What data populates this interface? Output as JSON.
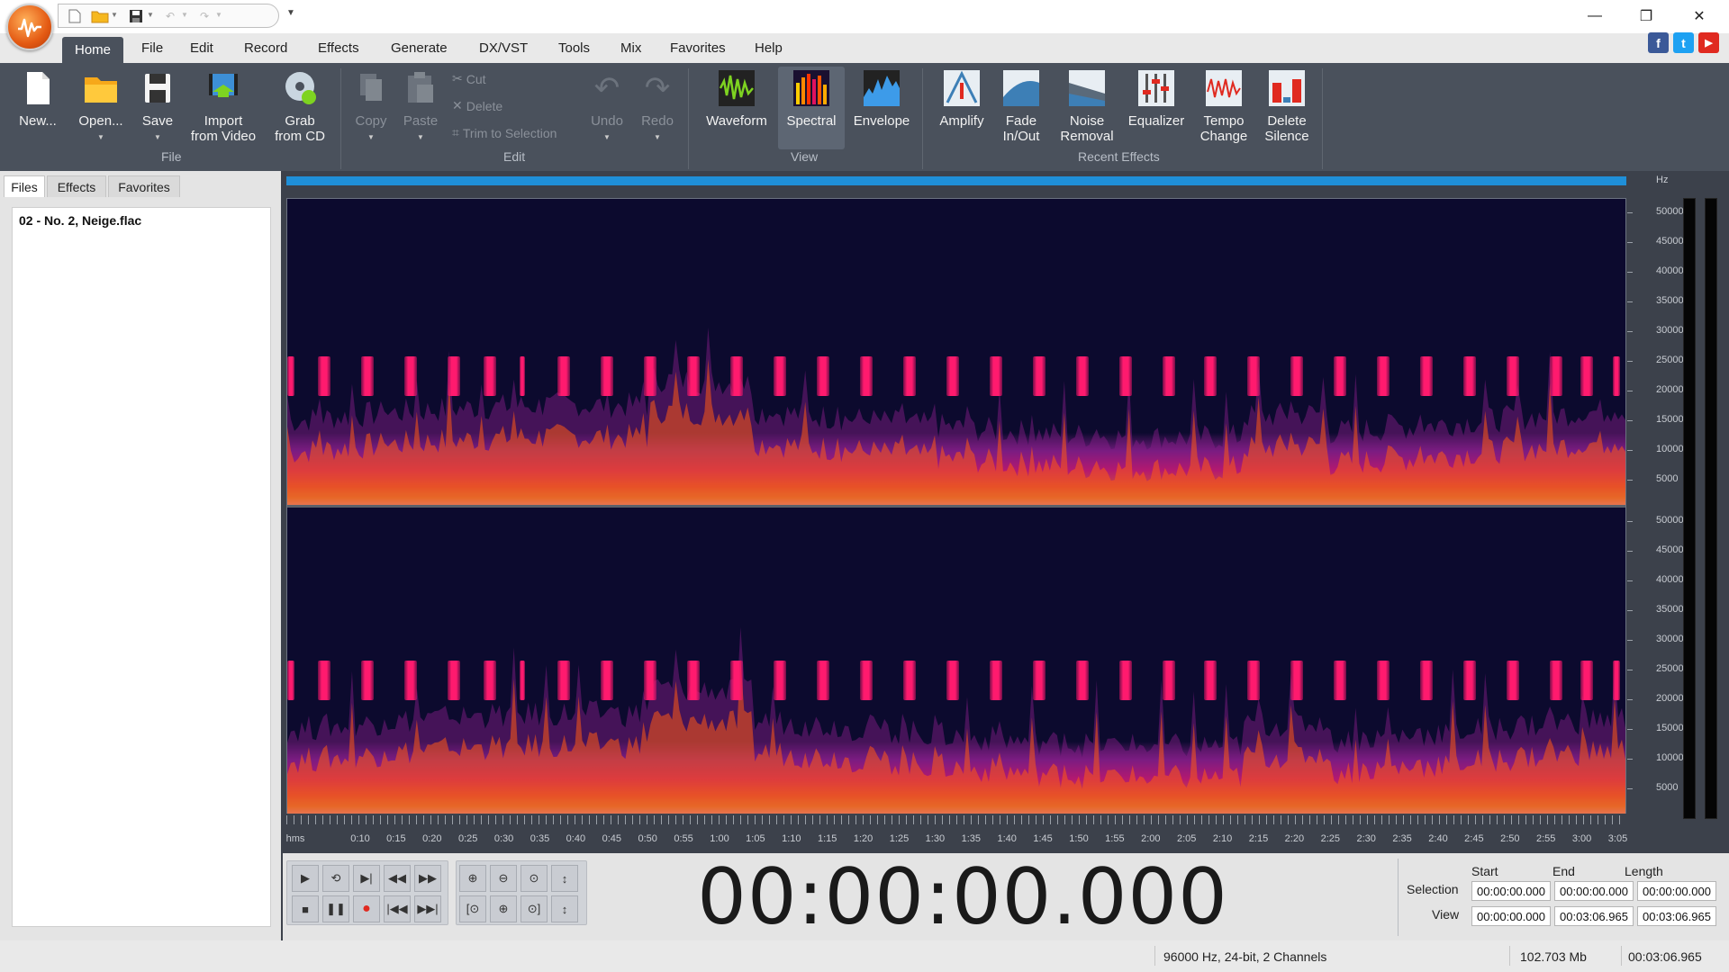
{
  "window": {
    "app_logo": "audio-wave-logo",
    "controls": {
      "minimize": "—",
      "restore": "❐",
      "close": "✕"
    }
  },
  "menu_tabs": [
    "Home",
    "File",
    "Edit",
    "Record",
    "Effects",
    "Generate",
    "DX/VST",
    "Tools",
    "Mix",
    "Favorites",
    "Help"
  ],
  "social": {
    "facebook": "f",
    "twitter": "t",
    "youtube": "▶"
  },
  "ribbon": {
    "file_group": "File",
    "new_label": "New...",
    "open_label": "Open...",
    "save_label": "Save",
    "import_video_label_1": "Import",
    "import_video_label_2": "from Video",
    "grab_cd_label_1": "Grab",
    "grab_cd_label_2": "from CD",
    "edit_group": "Edit",
    "copy_label": "Copy",
    "paste_label": "Paste",
    "cut_label": "Cut",
    "delete_label": "Delete",
    "trim_label": "Trim to Selection",
    "undo_label": "Undo",
    "redo_label": "Redo",
    "view_group": "View",
    "waveform_label": "Waveform",
    "spectral_label": "Spectral",
    "envelope_label": "Envelope",
    "effects_group": "Recent Effects",
    "amplify_label": "Amplify",
    "fade_label_1": "Fade",
    "fade_label_2": "In/Out",
    "noise_label_1": "Noise",
    "noise_label_2": "Removal",
    "equalizer_label": "Equalizer",
    "tempo_label_1": "Tempo",
    "tempo_label_2": "Change",
    "silence_label_1": "Delete",
    "silence_label_2": "Silence"
  },
  "side_panel": {
    "tabs": [
      "Files",
      "Effects",
      "Favorites"
    ],
    "active_tab": "Files",
    "files": [
      "02 - No. 2, Neige.flac"
    ]
  },
  "spectrogram": {
    "hz_unit": "Hz",
    "hz_ticks": [
      "50000",
      "45000",
      "40000",
      "35000",
      "30000",
      "25000",
      "20000",
      "15000",
      "10000",
      "5000"
    ],
    "colors": {
      "background": "#0c0a2e",
      "marker": "#ff1a6e",
      "overview": "#1f8fd8"
    }
  },
  "time_ruler": {
    "unit": "hms",
    "labels": [
      "0:10",
      "0:15",
      "0:20",
      "0:25",
      "0:30",
      "0:35",
      "0:40",
      "0:45",
      "0:50",
      "0:55",
      "1:00",
      "1:05",
      "1:10",
      "1:15",
      "1:20",
      "1:25",
      "1:30",
      "1:35",
      "1:40",
      "1:45",
      "1:50",
      "1:55",
      "2:00",
      "2:05",
      "2:10",
      "2:15",
      "2:20",
      "2:25",
      "2:30",
      "2:35",
      "2:40",
      "2:45",
      "2:50",
      "2:55",
      "3:00",
      "3:05"
    ]
  },
  "transport": {
    "current_time": "00:00:00.000",
    "headers": {
      "start": "Start",
      "end": "End",
      "length": "Length"
    },
    "selection_label": "Selection",
    "view_label": "View",
    "selection": {
      "start": "00:00:00.000",
      "end": "00:00:00.000",
      "length": "00:00:00.000"
    },
    "view": {
      "start": "00:00:00.000",
      "end": "00:03:06.965",
      "length": "00:03:06.965"
    }
  },
  "status": {
    "format": "96000 Hz, 24-bit, 2 Channels",
    "size": "102.703 Mb",
    "duration": "00:03:06.965"
  }
}
